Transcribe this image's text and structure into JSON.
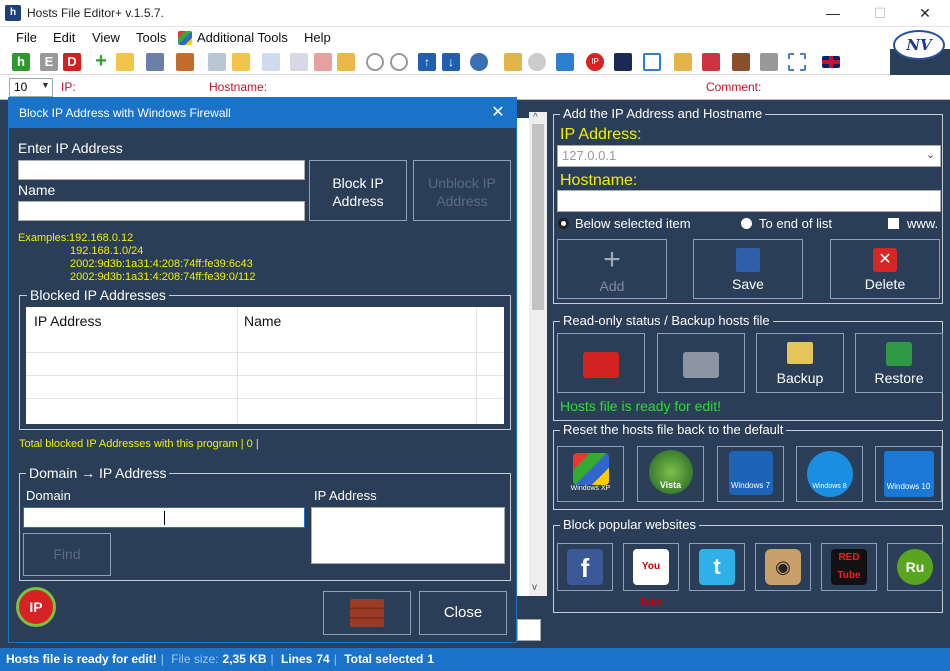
{
  "window": {
    "title": "Hosts File Editor+ v.1.5.7.",
    "minimize": "—",
    "maximize": "☐",
    "close": "✕"
  },
  "menu": {
    "file": "File",
    "edit": "Edit",
    "view": "View",
    "tools": "Tools",
    "additional_tools": "Additional Tools",
    "help": "Help"
  },
  "logo": "NV",
  "filter": {
    "lines_value": "10",
    "ip_label": "IP:",
    "hostname_label": "Hostname:",
    "comment_label": "Comment:"
  },
  "add_group": {
    "title": "Add the IP Address  and Hostname",
    "ip_label": "IP Address:",
    "ip_value": "127.0.0.1",
    "hostname_label": "Hostname:",
    "opt_below": "Below selected item",
    "opt_end": "To end of list",
    "opt_www": "www.",
    "add": "Add",
    "save": "Save",
    "delete": "Delete"
  },
  "readonly_group": {
    "title": "Read-only status / Backup hosts file",
    "backup": "Backup",
    "restore": "Restore",
    "status": "Hosts file is ready for edit!"
  },
  "reset_group": {
    "title": "Reset the hosts file back to the default",
    "os": [
      "Windows XP",
      "Vista",
      "Windows 7",
      "Windows 8",
      "Windows 10"
    ]
  },
  "block_group": {
    "title": "Block popular websites",
    "sites": [
      "f",
      "You Tube",
      "t",
      "◉",
      "RED Tube",
      "Ru"
    ]
  },
  "dialog": {
    "title": "Block IP Address with Windows Firewall",
    "enter_ip": "Enter IP Address",
    "name": "Name",
    "block_btn_l1": "Block  IP",
    "block_btn_l2": "Address",
    "unblock_btn_l1": "Unblock  IP",
    "unblock_btn_l2": "Address",
    "examples_label": "Examples:",
    "examples": [
      "192.168.0.12",
      "192.168.1.0/24",
      "2002:9d3b:1a31:4:208:74ff:fe39:6c43",
      "2002:9d3b:1a31:4:208:74ff:fe39:0/112"
    ],
    "blocked_title": "Blocked IP Addresses",
    "col_ip": "IP Address",
    "col_name": "Name",
    "total": "Total blocked IP Addresses with this program | 0 |",
    "domain_title": "Domain → IP Address",
    "domain_label": "Domain",
    "ipaddr_label": "IP Address",
    "find": "Find",
    "close": "Close"
  },
  "status": {
    "ready": "Hosts file is ready for edit!",
    "size_label": "File size:",
    "size": "2,35 KB",
    "lines_label": "Lines",
    "lines": "74",
    "selected_label": "Total selected",
    "selected": "1"
  }
}
